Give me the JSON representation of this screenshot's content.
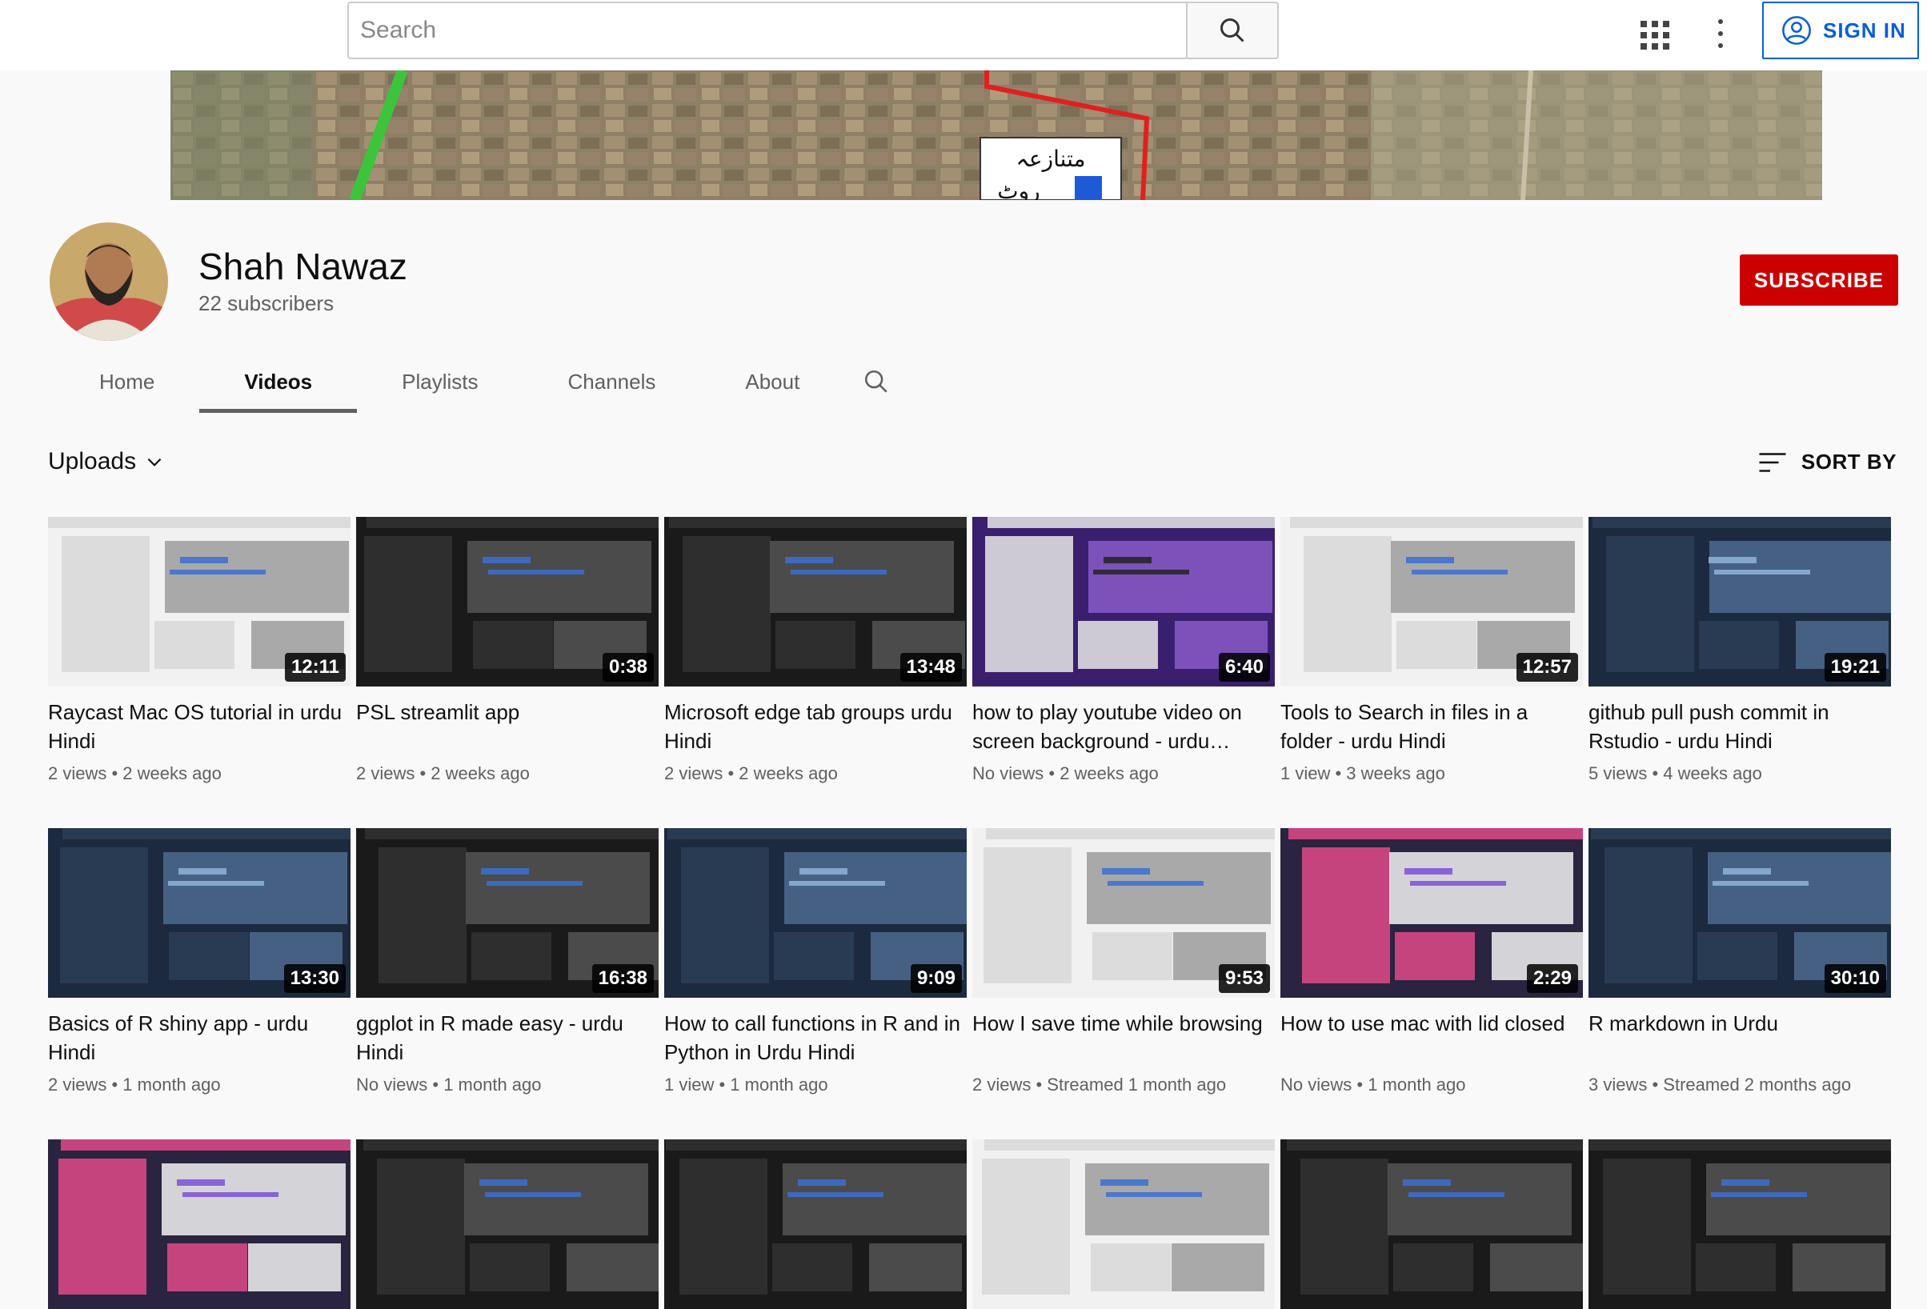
{
  "search": {
    "placeholder": "Search"
  },
  "header": {
    "signin_label": "SIGN IN"
  },
  "banner": {
    "overlay_text_line1": "متنازعہ",
    "overlay_text_line2": "روٹ"
  },
  "channel": {
    "name": "Shah Nawaz",
    "subscribers": "22 subscribers",
    "subscribe_label": "SUBSCRIBE"
  },
  "tabs": [
    {
      "label": "Home"
    },
    {
      "label": "Videos"
    },
    {
      "label": "Playlists"
    },
    {
      "label": "Channels"
    },
    {
      "label": "About"
    }
  ],
  "toolbar": {
    "uploads_label": "Uploads",
    "sort_label": "SORT BY"
  },
  "videos": [
    {
      "title": "Raycast Mac OS tutorial in urdu Hindi",
      "duration": "12:11",
      "views": "2 views",
      "age": "2 weeks ago",
      "thumb_style": "light"
    },
    {
      "title": "PSL streamlit app",
      "duration": "0:38",
      "views": "2 views",
      "age": "2 weeks ago",
      "thumb_style": "dark"
    },
    {
      "title": "Microsoft edge tab groups urdu Hindi",
      "duration": "13:48",
      "views": "2 views",
      "age": "2 weeks ago",
      "thumb_style": "dark"
    },
    {
      "title": "how to play youtube video on screen background - urdu…",
      "duration": "6:40",
      "views": "No views",
      "age": "2 weeks ago",
      "thumb_style": "purple"
    },
    {
      "title": "Tools to Search in files in a folder - urdu Hindi",
      "duration": "12:57",
      "views": "1 view",
      "age": "3 weeks ago",
      "thumb_style": "light"
    },
    {
      "title": "github pull push commit in Rstudio - urdu Hindi",
      "duration": "19:21",
      "views": "5 views",
      "age": "4 weeks ago",
      "thumb_style": "navy"
    },
    {
      "title": "Basics of R shiny app - urdu Hindi",
      "duration": "13:30",
      "views": "2 views",
      "age": "1 month ago",
      "thumb_style": "navy"
    },
    {
      "title": "ggplot in R made easy - urdu Hindi",
      "duration": "16:38",
      "views": "No views",
      "age": "1 month ago",
      "thumb_style": "dark"
    },
    {
      "title": "How to call functions in R and in Python in Urdu Hindi",
      "duration": "9:09",
      "views": "1 view",
      "age": "1 month ago",
      "thumb_style": "navy"
    },
    {
      "title": "How I save time while browsing",
      "duration": "9:53",
      "views": "2 views",
      "age": "Streamed 1 month ago",
      "thumb_style": "light"
    },
    {
      "title": "How to use mac with lid closed",
      "duration": "2:29",
      "views": "No views",
      "age": "1 month ago",
      "thumb_style": "pink"
    },
    {
      "title": "R markdown in Urdu",
      "duration": "30:10",
      "views": "3 views",
      "age": "Streamed 2 months ago",
      "thumb_style": "navy"
    },
    {
      "title": "",
      "duration": "",
      "views": "",
      "age": "",
      "thumb_style": "pink"
    },
    {
      "title": "",
      "duration": "",
      "views": "",
      "age": "",
      "thumb_style": "dark"
    },
    {
      "title": "",
      "duration": "",
      "views": "",
      "age": "",
      "thumb_style": "dark"
    },
    {
      "title": "",
      "duration": "",
      "views": "",
      "age": "",
      "thumb_style": "light"
    },
    {
      "title": "",
      "duration": "",
      "views": "",
      "age": "",
      "thumb_style": "dark"
    },
    {
      "title": "",
      "duration": "",
      "views": "",
      "age": "",
      "thumb_style": "dark"
    }
  ],
  "colors": {
    "brand_red": "#cc0000",
    "link_blue": "#065fd4"
  }
}
